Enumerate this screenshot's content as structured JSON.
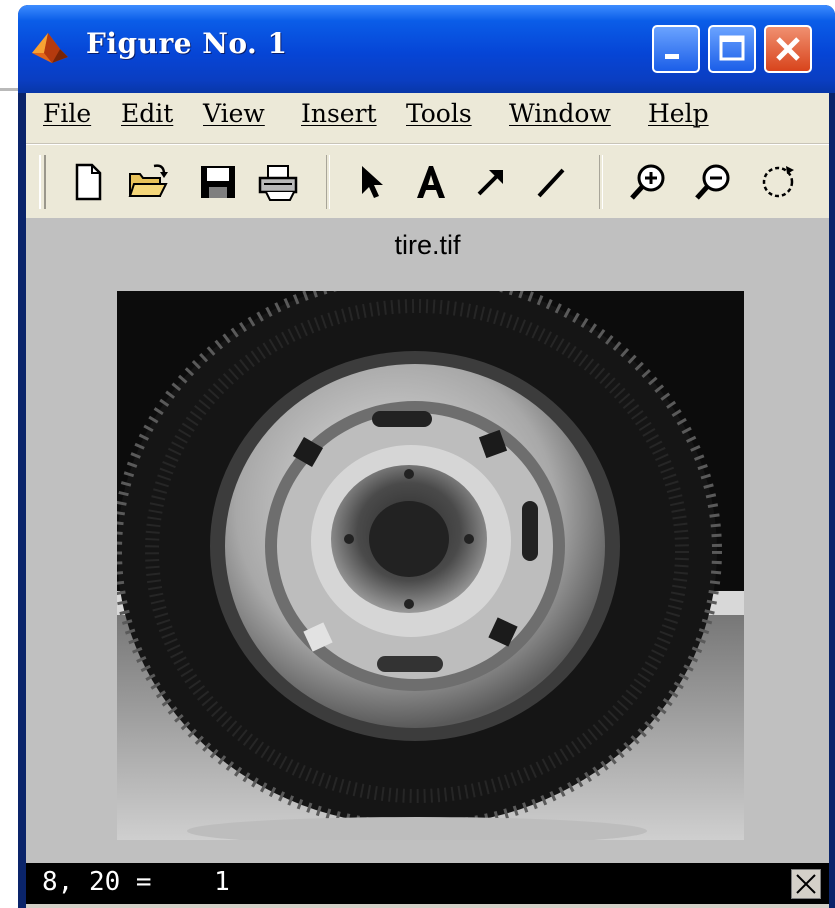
{
  "window": {
    "title": "Figure No. 1",
    "buttons": {
      "minimize": "minimize",
      "maximize": "maximize",
      "close": "close"
    }
  },
  "menu": [
    {
      "label": "File"
    },
    {
      "label": "Edit"
    },
    {
      "label": "View"
    },
    {
      "label": "Insert"
    },
    {
      "label": "Tools"
    },
    {
      "label": "Window"
    },
    {
      "label": "Help"
    }
  ],
  "toolbar": {
    "tools": [
      "new-figure-icon",
      "open-file-icon",
      "save-icon",
      "print-icon",
      "select-arrow-icon",
      "insert-text-icon",
      "insert-arrow-icon",
      "insert-line-icon",
      "zoom-in-icon",
      "zoom-out-icon",
      "rotate-3d-icon"
    ]
  },
  "figure": {
    "axes_title": "tire.tif"
  },
  "status": {
    "readout": "8, 20 =    1"
  },
  "colors": {
    "titlebar": "#0a5de8",
    "menubar": "#ece9d8",
    "figure_bg": "#c0c0c0",
    "close_button": "#d8441c"
  }
}
